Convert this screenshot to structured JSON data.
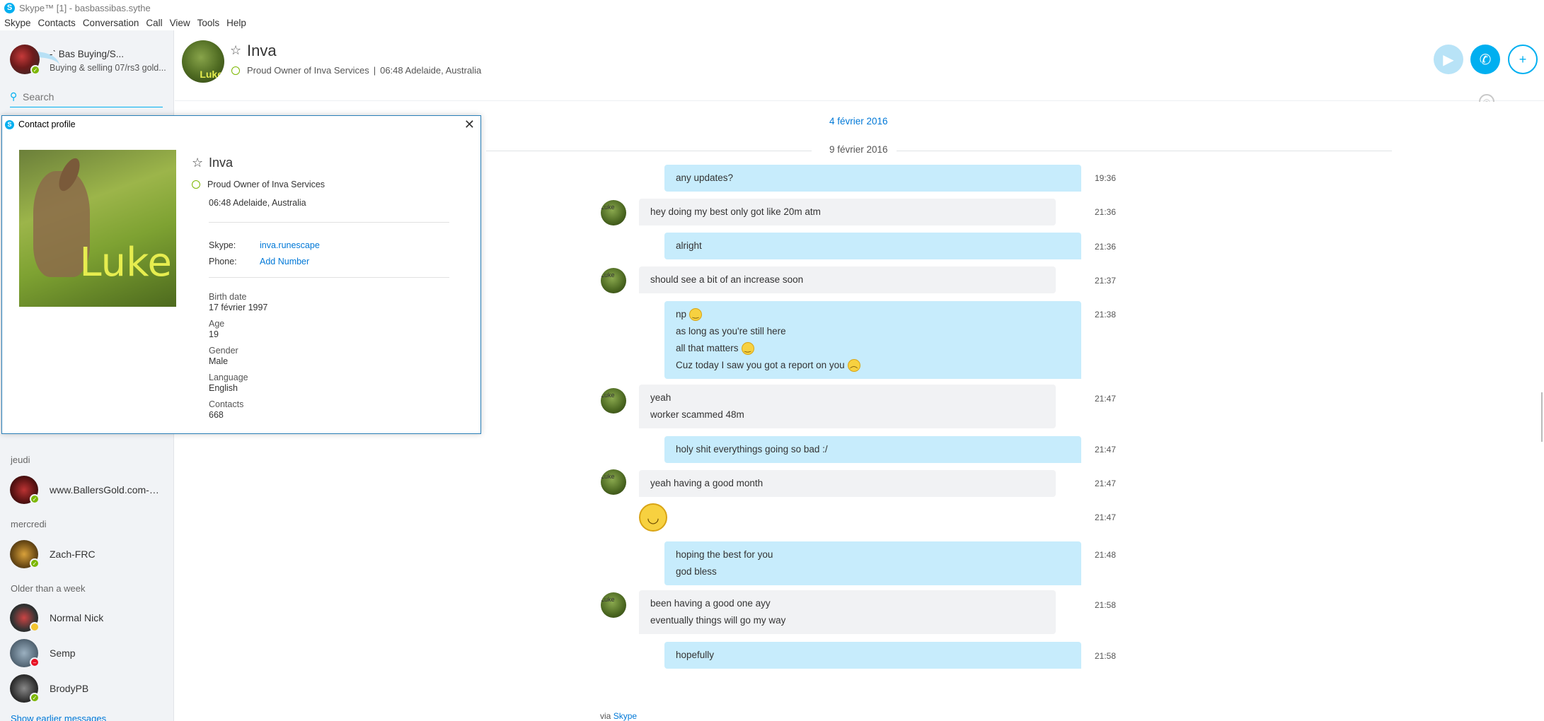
{
  "window": {
    "title": "Skype™ [1] - basbassibas.sythe"
  },
  "menu": [
    "Skype",
    "Contacts",
    "Conversation",
    "Call",
    "View",
    "Tools",
    "Help"
  ],
  "me": {
    "name": "-ˋ      Bas   Buying/S...",
    "mood": "Buying & selling 07/rs3 gold..."
  },
  "search": {
    "placeholder": "Search"
  },
  "recents": {
    "sections": {
      "thursday": "jeudi",
      "wednesday": "mercredi",
      "older": "Older than a week"
    },
    "items": [
      {
        "name": "www.BallersGold.com-The...",
        "status": "online"
      },
      {
        "name": "Zach-FRC",
        "status": "online"
      },
      {
        "name": "Normal Nick",
        "status": "away"
      },
      {
        "name": "Semp",
        "status": "busy"
      },
      {
        "name": "BrodyPB",
        "status": "online"
      }
    ],
    "show_earlier": "Show earlier messages"
  },
  "conversation": {
    "name": "Inva",
    "mood": "Proud Owner of Inva Services",
    "separator": "|",
    "location": "06:48 Adelaide, Australia",
    "avatar_text": "Luke"
  },
  "dates": {
    "d1": "4 février 2016",
    "d2": "9 février 2016"
  },
  "messages": [
    {
      "dir": "out",
      "lines": [
        "any updates?"
      ],
      "time": "19:36"
    },
    {
      "dir": "in",
      "lines": [
        "hey doing my best only got like 20m atm"
      ],
      "time": "21:36"
    },
    {
      "dir": "out",
      "lines": [
        "alright"
      ],
      "time": "21:36"
    },
    {
      "dir": "in",
      "lines": [
        "should see a bit of an increase soon"
      ],
      "time": "21:37"
    },
    {
      "dir": "out",
      "lines": [
        "np",
        "as long as you're still here",
        "all that matters",
        "Cuz today I saw you got a report on you"
      ],
      "time": "21:38"
    },
    {
      "dir": "in",
      "lines": [
        "yeah",
        "worker scammed 48m"
      ],
      "time": "21:47"
    },
    {
      "dir": "out",
      "lines": [
        "holy shit everythings going so bad :/"
      ],
      "time": "21:47"
    },
    {
      "dir": "in",
      "lines": [
        "yeah having a good month"
      ],
      "time": "21:47"
    },
    {
      "dir": "in",
      "lines": [],
      "time": "21:47"
    },
    {
      "dir": "out",
      "lines": [
        "hoping the best for you",
        "god bless"
      ],
      "time": "21:48"
    },
    {
      "dir": "in",
      "lines": [
        "been having a good one ayy",
        "eventually things will go my way"
      ],
      "time": "21:58"
    },
    {
      "dir": "out",
      "lines": [
        "hopefully"
      ],
      "time": "21:58"
    }
  ],
  "via": {
    "prefix": "via",
    "link": "Skype"
  },
  "profile": {
    "title": "Contact profile",
    "name": "Inva",
    "mood": "Proud Owner of Inva Services",
    "location": "06:48 Adelaide, Australia",
    "skype_label": "Skype:",
    "skype_value": "inva.runescape",
    "phone_label": "Phone:",
    "phone_value": "Add Number",
    "photo_text": "Luke",
    "fields": [
      {
        "label": "Birth date",
        "value": "17 février 1997"
      },
      {
        "label": "Age",
        "value": "19"
      },
      {
        "label": "Gender",
        "value": "Male"
      },
      {
        "label": "Language",
        "value": "English"
      },
      {
        "label": "Contacts",
        "value": "668"
      }
    ]
  },
  "colors": {
    "accent": "#00aff0",
    "bubble_out": "#c7ecfc",
    "bubble_in": "#f1f2f4",
    "online": "#7cb700"
  },
  "icons": {
    "video": "video-call-icon",
    "call": "phone-call-icon",
    "add": "add-people-icon",
    "globe": "globe-icon",
    "search": "search-icon"
  }
}
